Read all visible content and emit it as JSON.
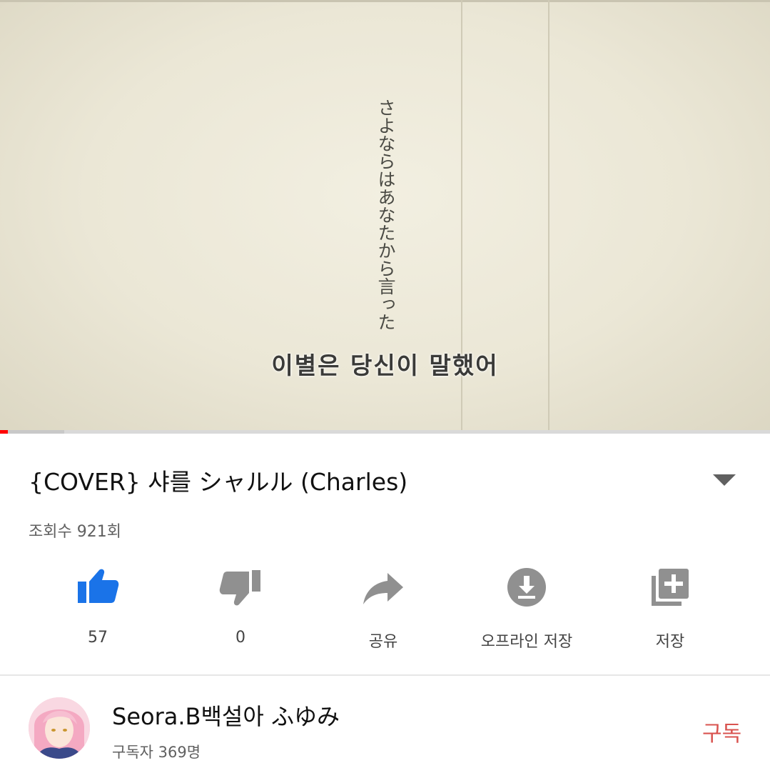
{
  "video": {
    "overlay_text": "さよならはあなたから言った",
    "subtitle": "이별은 당신이 말했어",
    "progress_fraction": 0.083,
    "played_fraction": 0.01
  },
  "details": {
    "title": "{COVER} 샤를 シャルル (Charles)",
    "views": "조회수 921회"
  },
  "actions": {
    "like": {
      "icon": "thumbs-up-icon",
      "label": "57"
    },
    "dislike": {
      "icon": "thumbs-down-icon",
      "label": "0"
    },
    "share": {
      "icon": "share-icon",
      "label": "공유"
    },
    "offline": {
      "icon": "download-icon",
      "label": "오프라인 저장"
    },
    "save": {
      "icon": "add-to-playlist-icon",
      "label": "저장"
    }
  },
  "channel": {
    "name": "Seora.B백설아 ふゆみ",
    "subscribers": "구독자 369명",
    "subscribe_label": "구독"
  },
  "colors": {
    "like_active": "#1a73e8",
    "icon_gray": "#909090",
    "subscribe": "#d9534f",
    "progress_played": "#ff0000"
  }
}
